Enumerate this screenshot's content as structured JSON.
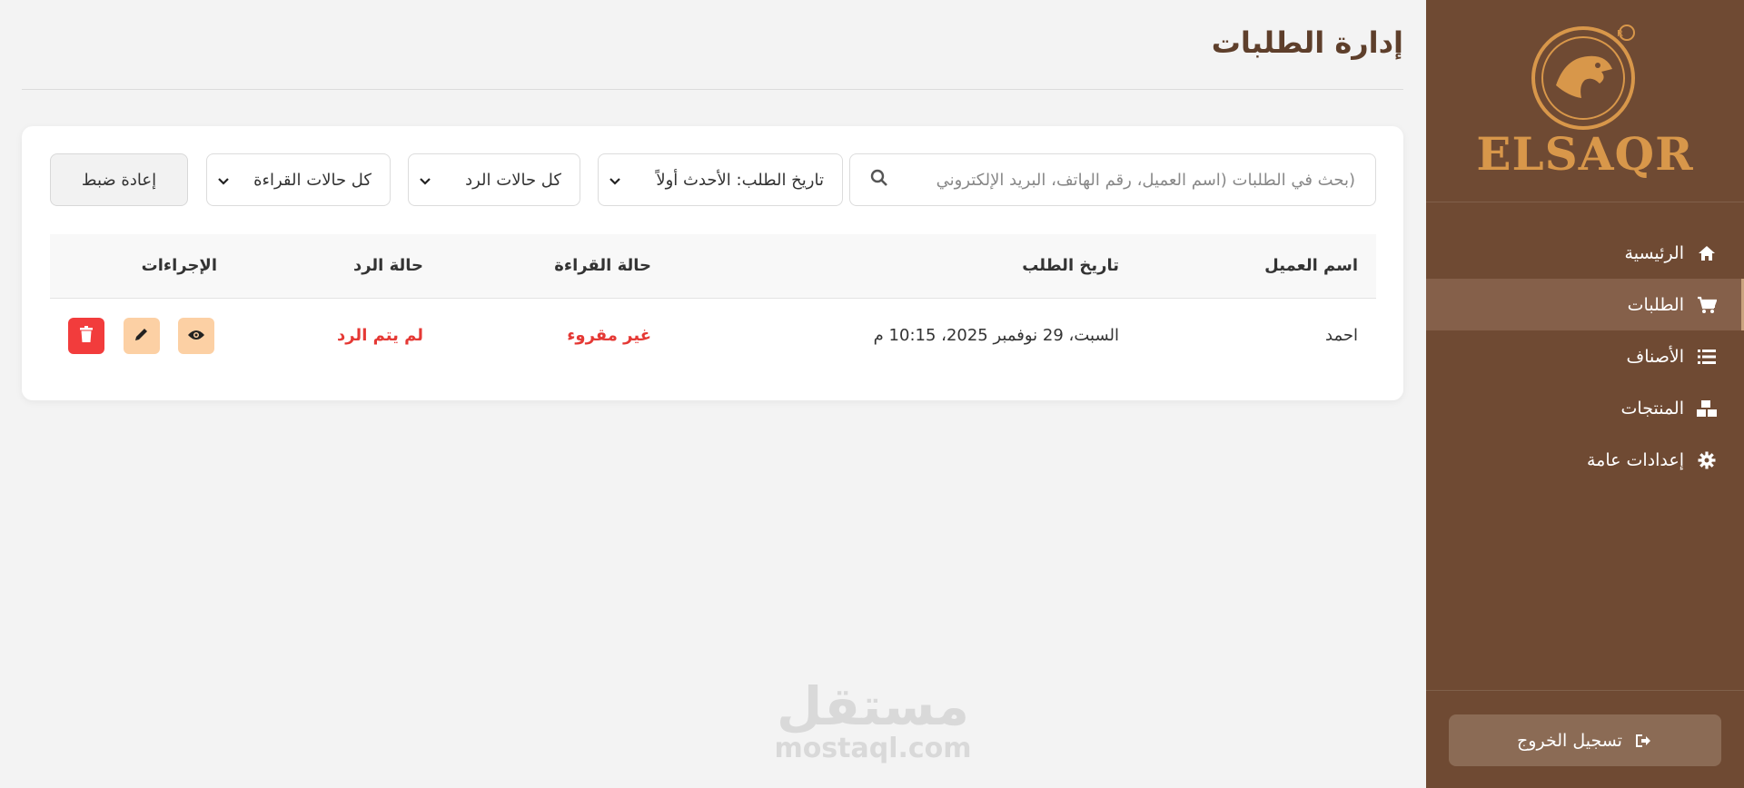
{
  "sidebar": {
    "brand": "ELSAQR",
    "nav": [
      {
        "label": "الرئيسية",
        "icon": "home-icon"
      },
      {
        "label": "الطلبات",
        "icon": "cart-icon",
        "active": true
      },
      {
        "label": "الأصناف",
        "icon": "list-icon"
      },
      {
        "label": "المنتجات",
        "icon": "boxes-icon"
      },
      {
        "label": "إعدادات عامة",
        "icon": "gear-icon"
      }
    ],
    "logout": "تسجيل الخروج"
  },
  "page": {
    "title": "إدارة الطلبات"
  },
  "filters": {
    "search_placeholder": "(بحث في الطلبات (اسم العميل، رقم الهاتف، البريد الإلكتروني",
    "sort_value": "تاريخ الطلب: الأحدث أولاً",
    "reply_value": "كل حالات الرد",
    "read_value": "كل حالات القراءة",
    "reset": "إعادة ضبط"
  },
  "table": {
    "headers": {
      "customer": "اسم العميل",
      "date": "تاريخ الطلب",
      "read": "حالة القراءة",
      "reply": "حالة الرد",
      "actions": "الإجراءات"
    },
    "rows": [
      {
        "customer": "احمد",
        "date": "السبت، 29 نوفمبر 2025، 10:15 م",
        "read": "غير مقروء",
        "reply": "لم يتم الرد"
      }
    ]
  },
  "watermark": {
    "ar": "مستقل",
    "en": "mostaql.com"
  },
  "colors": {
    "sidebar": "#6f4a33",
    "brand": "#d8974a",
    "danger": "#e53935",
    "accent_soft": "#fcd0a4"
  }
}
